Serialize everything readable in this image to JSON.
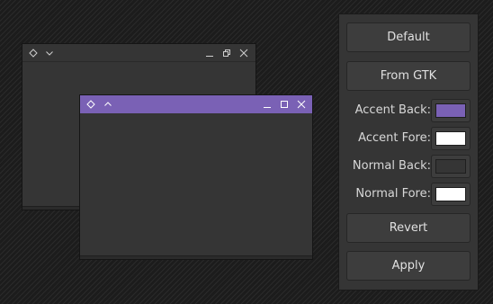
{
  "colors": {
    "accent_back": "#7a61b5",
    "accent_fore": "#ffffff",
    "normal_back": "#353535",
    "normal_fore": "#ffffff"
  },
  "back_window": {
    "icons": [
      "diamond-icon",
      "chevron-down-icon",
      "minimize-icon",
      "restore-icon",
      "close-icon"
    ]
  },
  "front_window": {
    "icons": [
      "diamond-icon",
      "chevron-up-icon",
      "minimize-icon",
      "maximize-icon",
      "close-icon"
    ]
  },
  "panel": {
    "default_label": "Default",
    "from_gtk_label": "From GTK",
    "accent_back_label": "Accent Back:",
    "accent_fore_label": "Accent Fore:",
    "normal_back_label": "Normal Back:",
    "normal_fore_label": "Normal Fore:",
    "revert_label": "Revert",
    "apply_label": "Apply"
  }
}
